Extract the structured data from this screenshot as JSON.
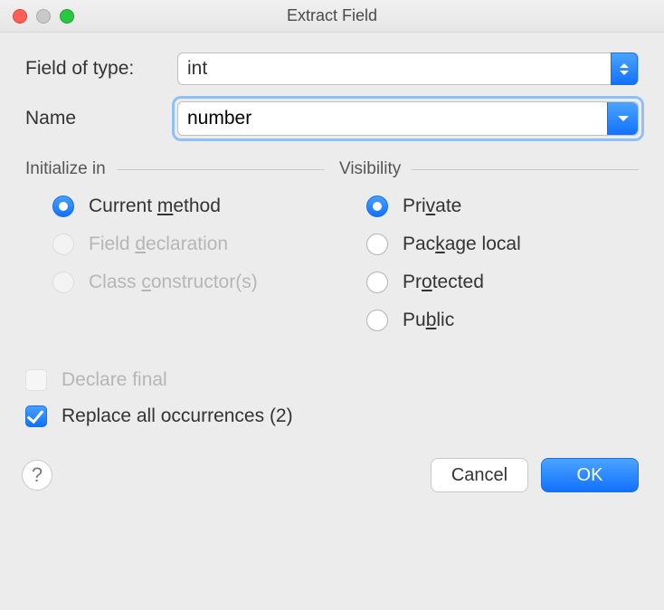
{
  "window": {
    "title": "Extract Field"
  },
  "fields": {
    "type_label": "Field of type:",
    "type_value": "int",
    "name_label": "Name",
    "name_value": "number"
  },
  "groups": {
    "initialize": {
      "header": "Initialize in",
      "options": {
        "current_method_pre": "Current ",
        "current_method_u": "m",
        "current_method_post": "ethod",
        "field_decl_pre": "Field ",
        "field_decl_u": "d",
        "field_decl_post": "eclaration",
        "class_ctor_pre": "Class ",
        "class_ctor_u": "c",
        "class_ctor_post": "onstructor(s)"
      }
    },
    "visibility": {
      "header": "Visibility",
      "options": {
        "private_pre": "Pri",
        "private_u": "v",
        "private_post": "ate",
        "pkg_pre": "Pac",
        "pkg_u": "k",
        "pkg_post": "age local",
        "protected_pre": "Pr",
        "protected_u": "o",
        "protected_post": "tected",
        "public_pre": "Pu",
        "public_u": "b",
        "public_post": "lic"
      }
    }
  },
  "checkboxes": {
    "declare_final": "Declare final",
    "replace_all": "Replace all occurrences (2)"
  },
  "buttons": {
    "help": "?",
    "cancel": "Cancel",
    "ok": "OK"
  }
}
